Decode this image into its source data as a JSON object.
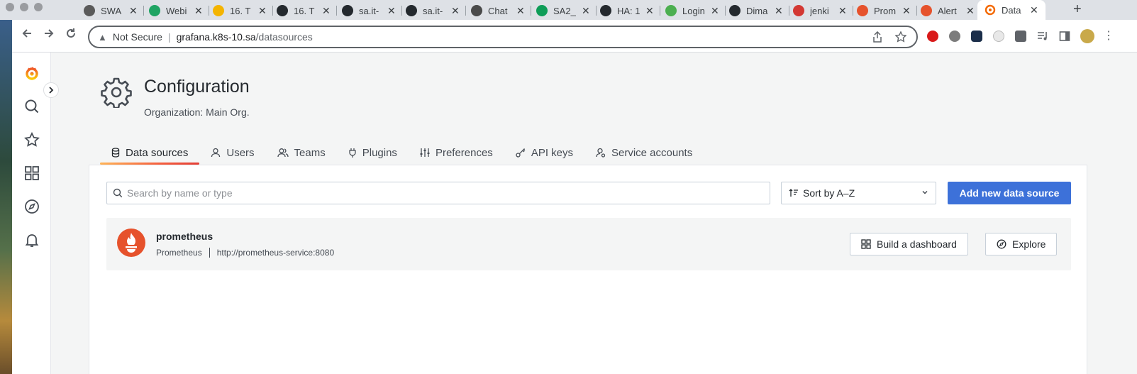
{
  "browser": {
    "tabs": [
      {
        "title": "SWA",
        "favicon": "swat-icon",
        "color": "#5a5a5a"
      },
      {
        "title": "Webi",
        "favicon": "drive-icon",
        "color": "#1fa463"
      },
      {
        "title": "16. T",
        "favicon": "slides-icon",
        "color": "#f4b400"
      },
      {
        "title": "16. T",
        "favicon": "github-icon",
        "color": "#24292e"
      },
      {
        "title": "sa.it-",
        "favicon": "github-icon",
        "color": "#24292e"
      },
      {
        "title": "sa.it-",
        "favicon": "github-icon",
        "color": "#24292e"
      },
      {
        "title": "Chat",
        "favicon": "openai-icon",
        "color": "#4a4a4a"
      },
      {
        "title": "SA2_",
        "favicon": "sheets-icon",
        "color": "#0f9d58"
      },
      {
        "title": "HA: 1",
        "favicon": "github-icon",
        "color": "#24292e"
      },
      {
        "title": "Login",
        "favicon": "bug-icon",
        "color": "#4caf50"
      },
      {
        "title": "Dima",
        "favicon": "github-icon",
        "color": "#24292e"
      },
      {
        "title": "jenki",
        "favicon": "jenkins-icon",
        "color": "#d33833"
      },
      {
        "title": "Prom",
        "favicon": "prometheus-icon",
        "color": "#e6522c"
      },
      {
        "title": "Alert",
        "favicon": "prometheus-icon",
        "color": "#e6522c"
      }
    ],
    "active_tab": {
      "title": "Data",
      "favicon": "grafana-icon"
    },
    "security_label": "Not Secure",
    "url_host": "grafana.k8s-10.sa",
    "url_path": "/datasources"
  },
  "page": {
    "title": "Configuration",
    "subtitle": "Organization: Main Org."
  },
  "tabs": [
    {
      "label": "Data sources",
      "icon": "database-icon",
      "active": true
    },
    {
      "label": "Users",
      "icon": "user-icon"
    },
    {
      "label": "Teams",
      "icon": "users-icon"
    },
    {
      "label": "Plugins",
      "icon": "plug-icon"
    },
    {
      "label": "Preferences",
      "icon": "sliders-icon"
    },
    {
      "label": "API keys",
      "icon": "key-icon"
    },
    {
      "label": "Service accounts",
      "icon": "service-account-icon"
    }
  ],
  "search": {
    "placeholder": "Search by name or type"
  },
  "sort": {
    "label": "Sort by A–Z"
  },
  "add_button": "Add new data source",
  "datasources": [
    {
      "name": "prometheus",
      "type": "Prometheus",
      "url": "http://prometheus-service:8080",
      "build_label": "Build a dashboard",
      "explore_label": "Explore"
    }
  ],
  "colors": {
    "primary": "#3d71d9",
    "prometheus": "#e6522c",
    "grafana": "#f46800"
  }
}
